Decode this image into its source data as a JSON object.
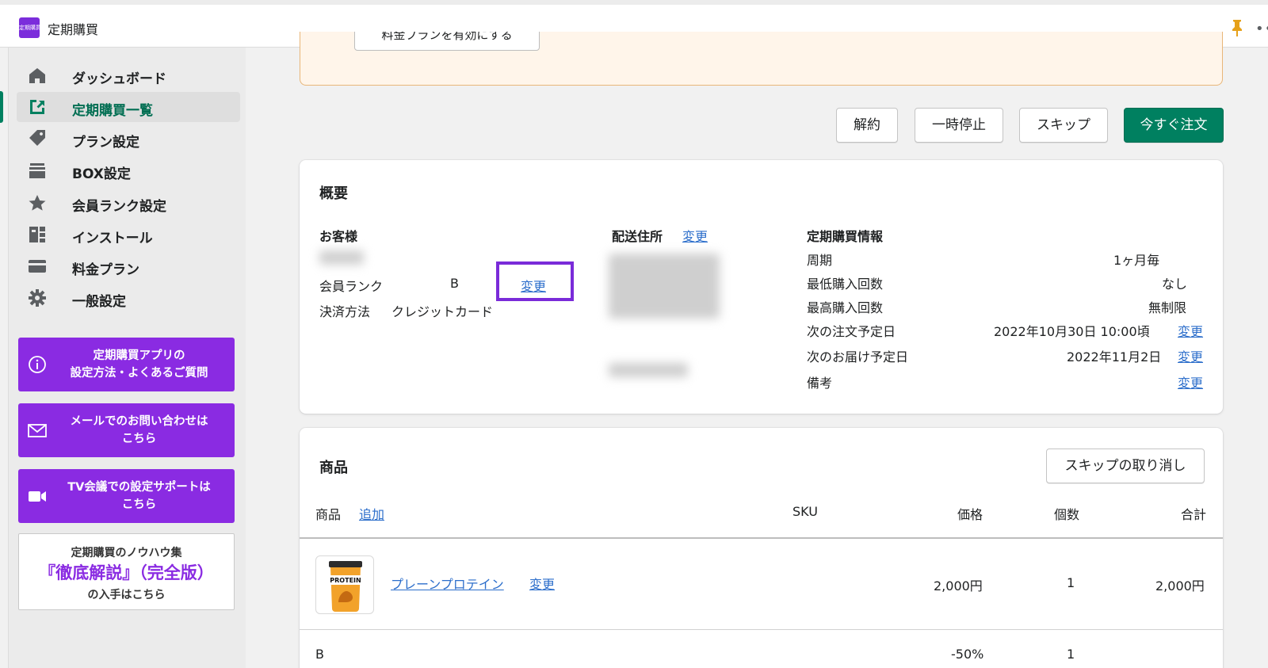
{
  "app": {
    "title": "定期購買",
    "logo_text": "定期購買"
  },
  "sidebar": {
    "items": [
      {
        "label": "ダッシュボード",
        "icon": "home-icon"
      },
      {
        "label": "定期購買一覧",
        "icon": "subscription-list-icon",
        "active": true
      },
      {
        "label": "プラン設定",
        "icon": "tag-icon"
      },
      {
        "label": "BOX設定",
        "icon": "box-icon"
      },
      {
        "label": "会員ランク設定",
        "icon": "star-icon"
      },
      {
        "label": "インストール",
        "icon": "install-icon"
      },
      {
        "label": "料金プラン",
        "icon": "credit-card-icon"
      },
      {
        "label": "一般設定",
        "icon": "gear-icon"
      }
    ],
    "promos": [
      {
        "text": "定期購買アプリの\n設定方法・よくあるご質問",
        "icon": "info-icon"
      },
      {
        "text": "メールでのお問い合わせは\nこちら",
        "icon": "mail-icon"
      },
      {
        "text": "TV会議での設定サポートは\nこちら",
        "icon": "video-icon"
      }
    ],
    "knowhow": {
      "line1": "定期購買のノウハウ集",
      "line2": "『徹底解説』（完全版）",
      "line3": "の入手はこちら"
    }
  },
  "banner": {
    "button_label": "料金プランを有効にする"
  },
  "actions": {
    "cancel": "解約",
    "pause": "一時停止",
    "skip": "スキップ",
    "order_now": "今すぐ注文"
  },
  "overview": {
    "title": "概要",
    "customer": {
      "heading": "お客様",
      "rank_label": "会員ランク",
      "rank_value": "B",
      "rank_change": "変更",
      "payment_label": "決済方法",
      "payment_value": "クレジットカード"
    },
    "shipping": {
      "heading": "配送住所",
      "change": "変更"
    },
    "subscription_info": {
      "heading": "定期購買情報",
      "rows": [
        {
          "label": "周期",
          "value": "1ヶ月毎",
          "change": ""
        },
        {
          "label": "最低購入回数",
          "value": "なし",
          "change": ""
        },
        {
          "label": "最高購入回数",
          "value": "無制限",
          "change": ""
        },
        {
          "label": "次の注文予定日",
          "value": "2022年10月30日 10:00頃",
          "change": "変更"
        },
        {
          "label": "次のお届け予定日",
          "value": "2022年11月2日",
          "change": "変更"
        },
        {
          "label": "備考",
          "value": "",
          "change": "変更"
        }
      ]
    }
  },
  "products": {
    "title": "商品",
    "cancel_skip": "スキップの取り消し",
    "headers": {
      "product": "商品",
      "add": "追加",
      "sku": "SKU",
      "price": "価格",
      "qty": "個数",
      "total": "合計"
    },
    "rows": [
      {
        "name": "プレーンプロテイン",
        "change": "変更",
        "price": "2,000円",
        "qty": "1",
        "total": "2,000円",
        "thumb_label": "PROTEIN"
      },
      {
        "name": "B",
        "price": "-50%",
        "qty": "1"
      }
    ]
  },
  "colors": {
    "brand": "#008060",
    "purple": "#8a2be2",
    "link": "#2c6ecb",
    "warning_bg": "#fff5ea"
  }
}
